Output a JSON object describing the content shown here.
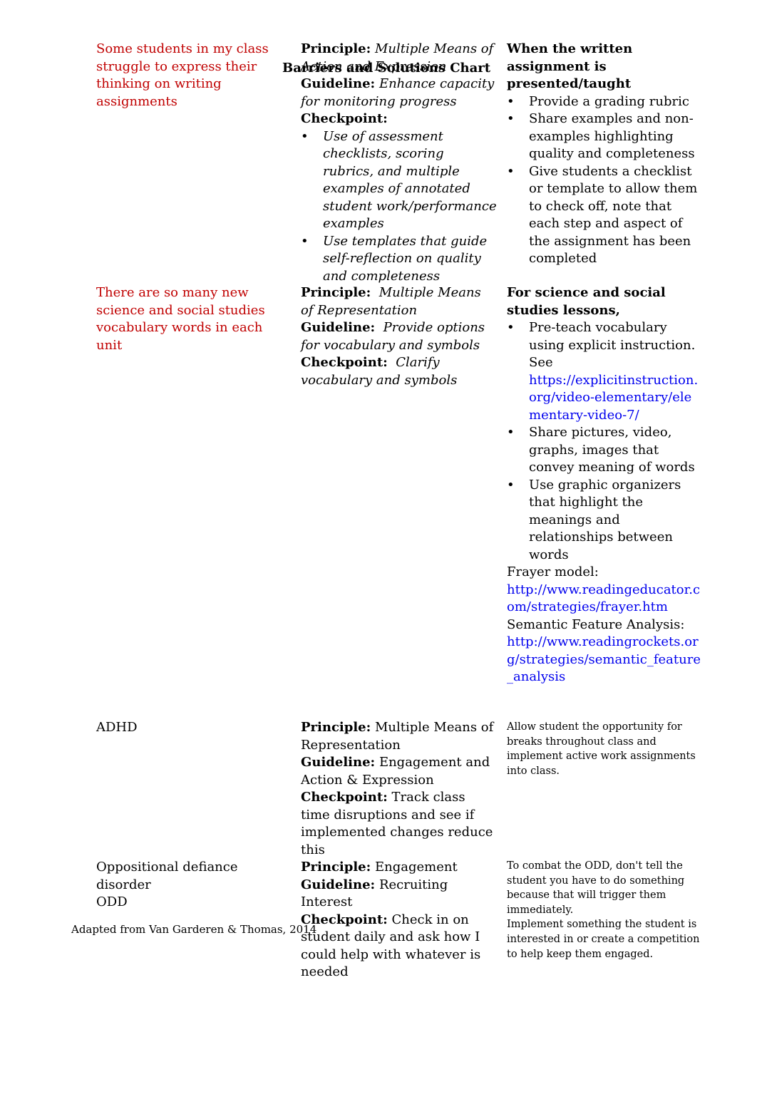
{
  "document": {
    "title": "Barriers and Solutions Chart",
    "footer": "Adapted from Van Garderen & Thomas, 2014"
  },
  "colors": {
    "barrier_red": "#c00000",
    "link_blue": "#0000ee"
  },
  "rows": [
    {
      "barrier": "Some students in my class struggle to express their thinking on writing assignments",
      "principle_label": "Principle:",
      "principle": "Multiple Means of Action and Expression",
      "guideline_label": "Guideline:",
      "guideline": "Enhance capacity for monitoring progress",
      "checkpoint_label": "Checkpoint:",
      "checkpoints": [
        "Use of assessment checklists, scoring rubrics, and multiple examples of annotated student work/performance examples",
        "Use templates that guide self-reflection on quality and completeness"
      ],
      "solution_heading": "When the written assignment is presented/taught",
      "solutions": [
        "Provide a grading rubric",
        "Share examples and non-examples highlighting quality and completeness",
        "Give students a checklist or template to allow them to check off, note that each step and aspect of the assignment has been completed"
      ]
    },
    {
      "barrier": "There are so many new science and social studies vocabulary words in each unit",
      "principle_label": "Principle:",
      "principle": "Multiple Means of Representation",
      "guideline_label": "Guideline:",
      "guideline": "Provide options for vocabulary and symbols",
      "checkpoint_label": "Checkpoint:",
      "checkpoint": "Clarify vocabulary and symbols",
      "solution_heading": "For science and social studies lessons,",
      "solutions": [
        {
          "text": "Pre-teach vocabulary using explicit instruction. See",
          "link": "https://explicitinstruction.org/video-elementary/elementary-video-7/"
        },
        {
          "text": "Share pictures, video, graphs, images that convey meaning of words"
        },
        {
          "text": "Use graphic organizers that highlight the meanings and relationships between words"
        }
      ],
      "resources": [
        {
          "label": "Frayer model:",
          "link": "http://www.readingeducator.com/strategies/frayer.htm"
        },
        {
          "label": "Semantic Feature Analysis:",
          "link": "http://www.readingrockets.org/strategies/semantic_feature_analysis"
        }
      ]
    },
    {
      "barrier": "ADHD",
      "principle_label": "Principle:",
      "principle": "Multiple Means of Representation",
      "guideline_label": "Guideline:",
      "guideline": "Engagement and Action & Expression",
      "checkpoint_label": "Checkpoint:",
      "checkpoint": "Track class time disruptions and see if implemented changes reduce this",
      "solution": "Allow student the opportunity for breaks throughout class and implement active work assignments into class."
    },
    {
      "barrier_lines": [
        "Oppositional defiance disorder",
        "ODD"
      ],
      "principle_label": "Principle:",
      "principle": "Engagement",
      "guideline_label": "Guideline:",
      "guideline": "Recruiting Interest",
      "checkpoint_label": "Checkpoint:",
      "checkpoint": "Check in on student daily and ask how I could help with whatever is needed",
      "solution_lines": [
        "To combat the ODD, don't tell the student you have to do something because that will trigger them immediately.",
        "Implement something the student is interested in or create a competition to help keep them engaged."
      ]
    }
  ]
}
